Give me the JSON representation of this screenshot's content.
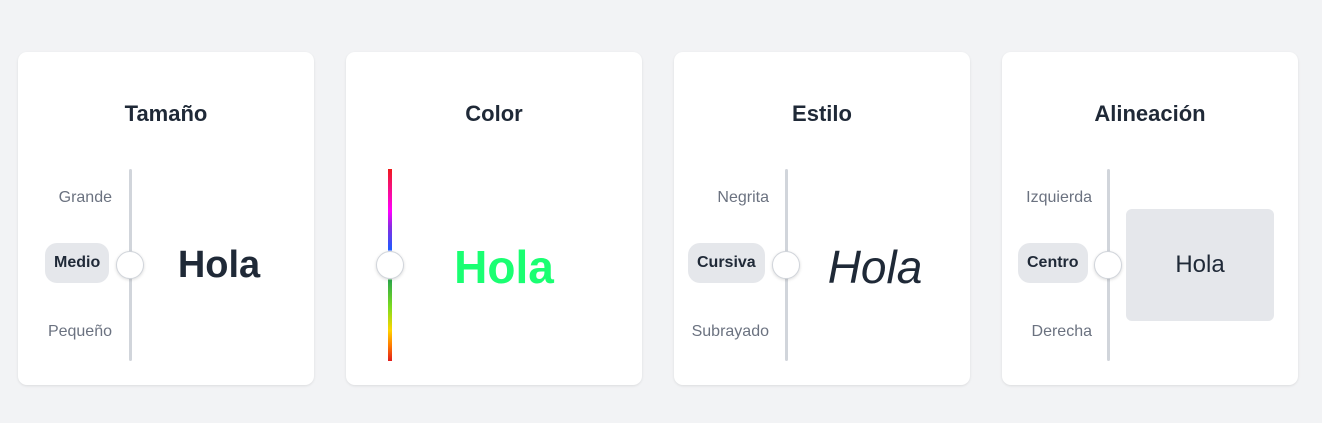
{
  "colors": {
    "page_background": "#f2f3f5",
    "card_background": "#ffffff",
    "heading_text": "#1f2937",
    "muted_text": "#6b7280",
    "pill_background": "#e5e7eb",
    "track": "#d1d5db",
    "preview_green": "#1aff72"
  },
  "cards": [
    {
      "title": "Tamaño",
      "options": [
        "Grande",
        "Medio",
        "Pequeño"
      ],
      "selected": "Medio",
      "preview_text": "Hola"
    },
    {
      "title": "Color",
      "selected_color": "#1aff72",
      "preview_text": "Hola"
    },
    {
      "title": "Estilo",
      "options": [
        "Negrita",
        "Cursiva",
        "Subrayado"
      ],
      "selected": "Cursiva",
      "preview_text": "Hola"
    },
    {
      "title": "Alineación",
      "options": [
        "Izquierda",
        "Centro",
        "Derecha"
      ],
      "selected": "Centro",
      "preview_text": "Hola"
    }
  ]
}
